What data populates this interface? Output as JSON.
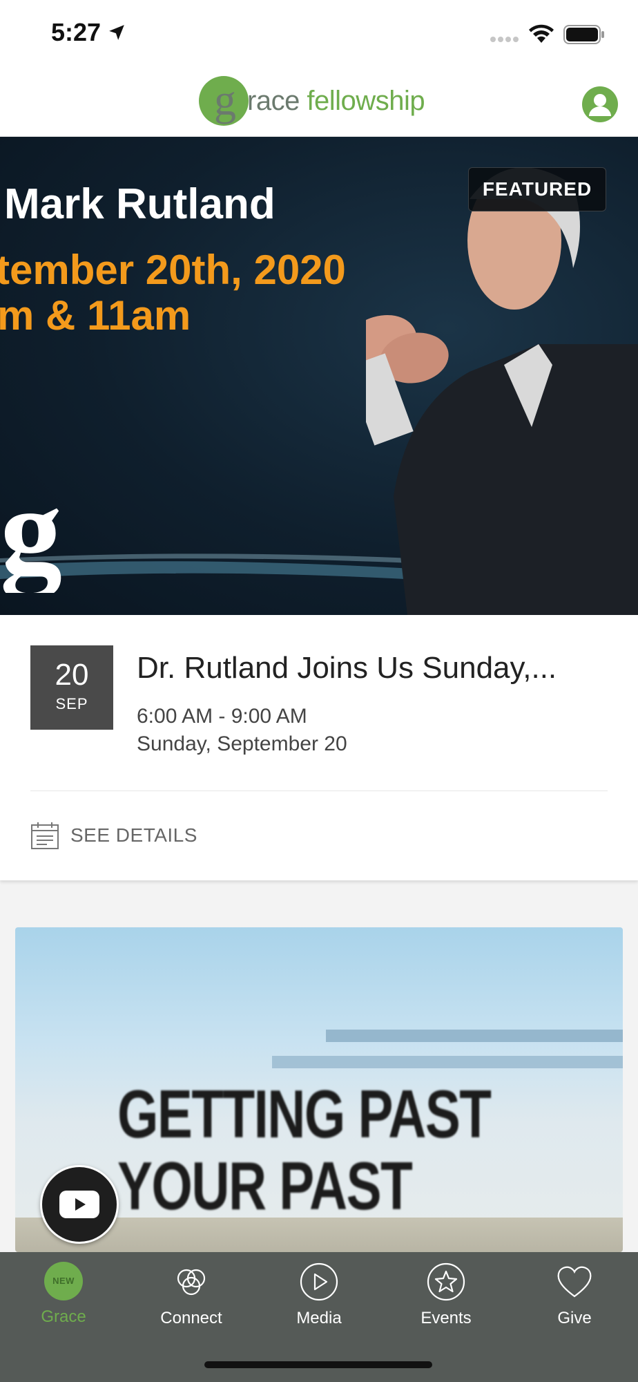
{
  "status_bar": {
    "time": "5:27"
  },
  "header": {
    "logo_letter": "g",
    "logo_text_dark": "race",
    "logo_text_green": " fellowship"
  },
  "featured": {
    "badge": "FEATURED",
    "line1": "Mark Rutland",
    "line2": "tember 20th, 2020",
    "line3": "m & 11am",
    "banner_logo_letter": "g"
  },
  "event": {
    "day": "20",
    "month": "SEP",
    "title": "Dr. Rutland Joins Us Sunday,...",
    "time": "6:00 AM - 9:00 AM",
    "date": "Sunday, September 20",
    "see_details": "SEE DETAILS"
  },
  "media_card": {
    "title_line1": "GETTING PAST",
    "title_line2": "YOUR PAST"
  },
  "tab_bar": {
    "tabs": [
      {
        "label": "Grace",
        "badge": "NEW",
        "icon": "new-badge-icon",
        "active": true
      },
      {
        "label": "Connect",
        "icon": "rings-icon",
        "active": false
      },
      {
        "label": "Media",
        "icon": "play-circle-icon",
        "active": false
      },
      {
        "label": "Events",
        "icon": "star-circle-icon",
        "active": false
      },
      {
        "label": "Give",
        "icon": "heart-icon",
        "active": false
      }
    ]
  },
  "colors": {
    "brand_green": "#6fad4d",
    "banner_orange": "#f39a1c",
    "tab_bar_bg": "#555a57"
  }
}
